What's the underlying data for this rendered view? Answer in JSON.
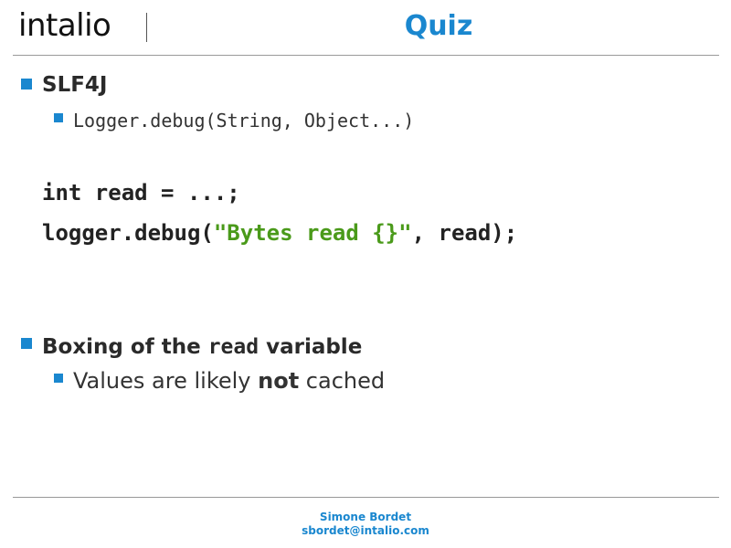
{
  "header": {
    "logo_text": "intalio",
    "title": "Quiz"
  },
  "bullets": {
    "item1": {
      "label": "SLF4J",
      "sub": "Logger.debug(String, Object...)"
    },
    "code": {
      "line1": "int read = ...;",
      "line2_pre": "logger.debug(",
      "line2_str": "\"Bytes read {}\"",
      "line2_post": ", read);"
    },
    "item2": {
      "label_pre": "Boxing of the ",
      "label_code": "read",
      "label_post": " variable",
      "sub_pre": "Values are likely ",
      "sub_bold": "not",
      "sub_post": " cached"
    }
  },
  "footer": {
    "author": "Simone Bordet",
    "email": "sbordet@intalio.com"
  },
  "colors": {
    "accent": "#1a87cf",
    "string": "#4a9a1a"
  }
}
